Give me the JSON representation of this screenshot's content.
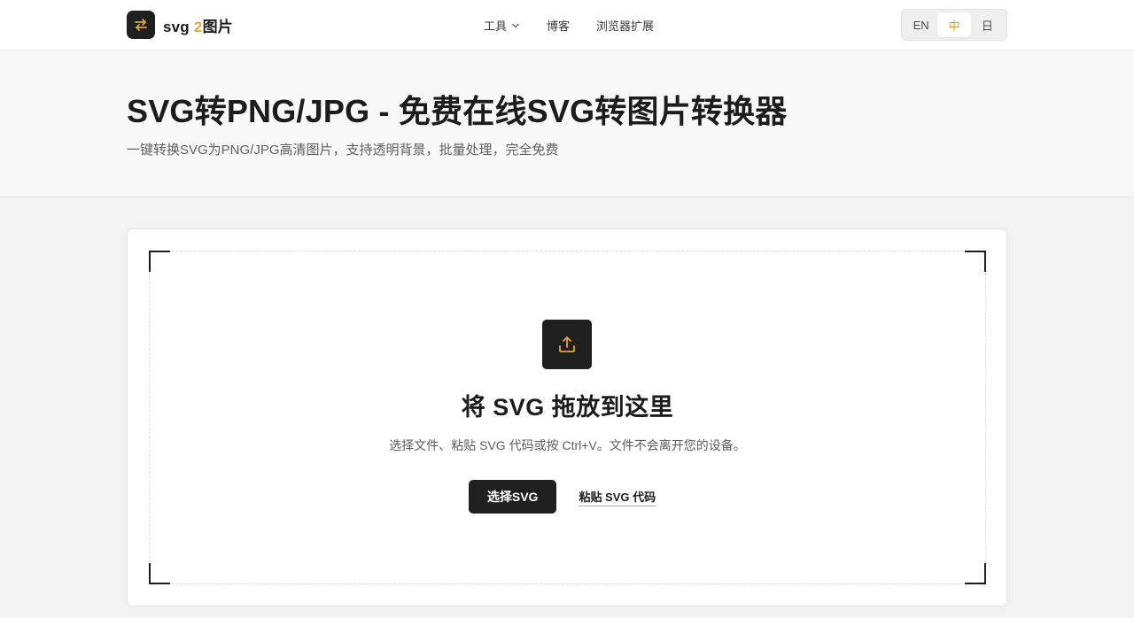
{
  "header": {
    "brand_prefix": "svg",
    "brand_accent": "2",
    "brand_rest": "图片",
    "logo_icon": "swap-arrows-icon",
    "nav": [
      {
        "label": "工具",
        "has_dropdown": true
      },
      {
        "label": "博客"
      },
      {
        "label": "浏览器扩展"
      }
    ],
    "languages": [
      "EN",
      "中",
      "日"
    ],
    "active_language": "中"
  },
  "hero": {
    "title": "SVG转PNG/JPG - 免费在线SVG转图片转换器",
    "subtitle": "一键转换SVG为PNG/JPG高清图片，支持透明背景，批量处理，完全免费"
  },
  "dropzone": {
    "icon": "upload-icon",
    "title": "将 SVG 拖放到这里",
    "description": "选择文件、粘贴 SVG 代码或按 Ctrl+V。文件不会离开您的设备。",
    "primary_button": "选择SVG",
    "secondary_link": "粘贴 SVG 代码"
  },
  "colors": {
    "accent": "#e3a72f",
    "dark": "#1f1f1f",
    "background": "#f3f3ef"
  }
}
